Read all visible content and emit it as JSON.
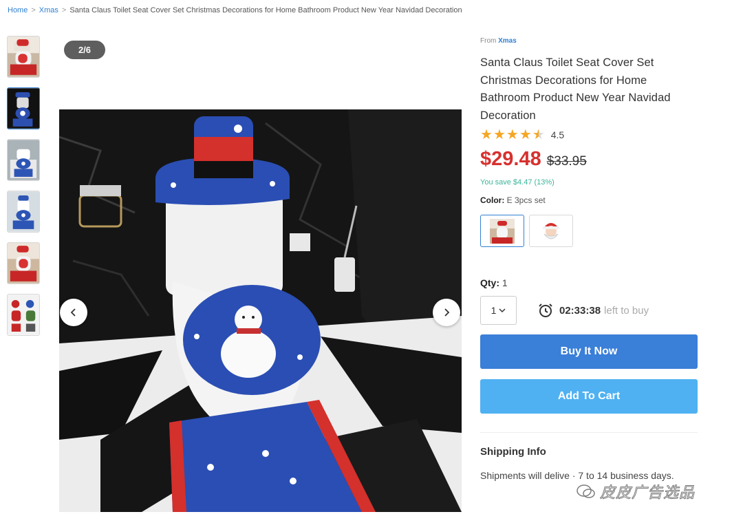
{
  "breadcrumb": {
    "home": "Home",
    "category": "Xmas",
    "current": "Santa Claus Toilet Seat Cover Set Christmas Decorations for Home Bathroom Product New Year Navidad Decoration",
    "separator": ">"
  },
  "gallery": {
    "counter": "2/6",
    "thumb_count": 6,
    "active_index": 1
  },
  "product": {
    "from_label": "From",
    "store": "Xmas",
    "title": "Santa Claus Toilet Seat Cover Set Christmas Decorations for Home Bathroom Product New Year Navidad Decoration",
    "rating": 4.5,
    "rating_text": "4.5",
    "price": "$29.48",
    "old_price": "$33.95",
    "save_text": "You save $4.47 (13%)",
    "color_label": "Color:",
    "color_value": "E 3pcs set",
    "qty_label": "Qty:",
    "qty_value": "1",
    "qty_select": "1",
    "timer_time": "02:33:38",
    "timer_text": "left to buy",
    "buy_now": "Buy It Now",
    "add_to_cart": "Add To Cart",
    "shipping_title": "Shipping Info",
    "shipping_text": "Shipments will delive · 7 to 14 business days."
  },
  "watermark": {
    "text": "皮皮广告选品"
  },
  "colors": {
    "accent": "#2f80d1",
    "price": "#d6312f",
    "save": "#3bb59a",
    "buy_button": "#3a7fd8",
    "cart_button": "#4fb1f2",
    "star": "#f5a623"
  },
  "icons": {
    "prev": "chevron-left-icon",
    "next": "chevron-right-icon",
    "timer": "alarm-clock-icon",
    "dropdown": "chevron-down-icon"
  }
}
